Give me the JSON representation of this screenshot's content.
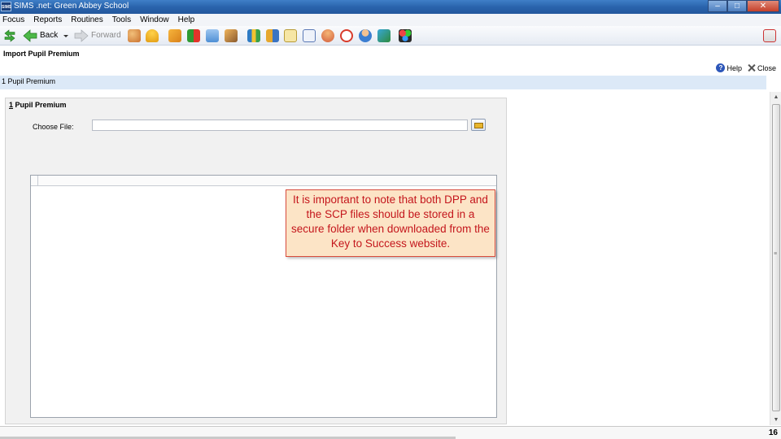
{
  "window": {
    "app_logo": "SIMS",
    "title": "SIMS .net: Green Abbey School",
    "controls": {
      "minimize": "–",
      "maximize": "□",
      "close": "✕"
    }
  },
  "menu": [
    "Focus",
    "Reports",
    "Routines",
    "Tools",
    "Window",
    "Help"
  ],
  "toolbar": {
    "back_label": "Back",
    "forward_label": "Forward",
    "icons": [
      "refresh-arrows-icon",
      "back-arrow-icon",
      "dropdown-arrow-icon",
      "forward-arrow-icon",
      "people-icon",
      "person-search-icon",
      "book-icon",
      "flag-icon",
      "envelope-icon",
      "puzzle-icon",
      "map-icon",
      "chart-icon",
      "document-icon",
      "edit-icon",
      "group-icon",
      "clock-icon",
      "user-icon",
      "swap-icon",
      "apps-icon",
      "exit-icon"
    ]
  },
  "page": {
    "title": "Import Pupil Premium",
    "help_label": "Help",
    "close_label": "Close",
    "section_link": "1 Pupil Premium"
  },
  "panel": {
    "heading_number": "1",
    "heading_text": " Pupil Premium",
    "choose_file_label": "Choose File:",
    "file_value": ""
  },
  "note": {
    "text": "It is important to note that both DPP and the SCP files should be stored in a secure folder when downloaded from the Key to Success website."
  },
  "status": {
    "page_number": "16"
  },
  "colors": {
    "title_bar": "#2a64ad",
    "section_strip": "#dce9f7",
    "note_background": "#fce4c6",
    "note_text": "#c4161c"
  }
}
